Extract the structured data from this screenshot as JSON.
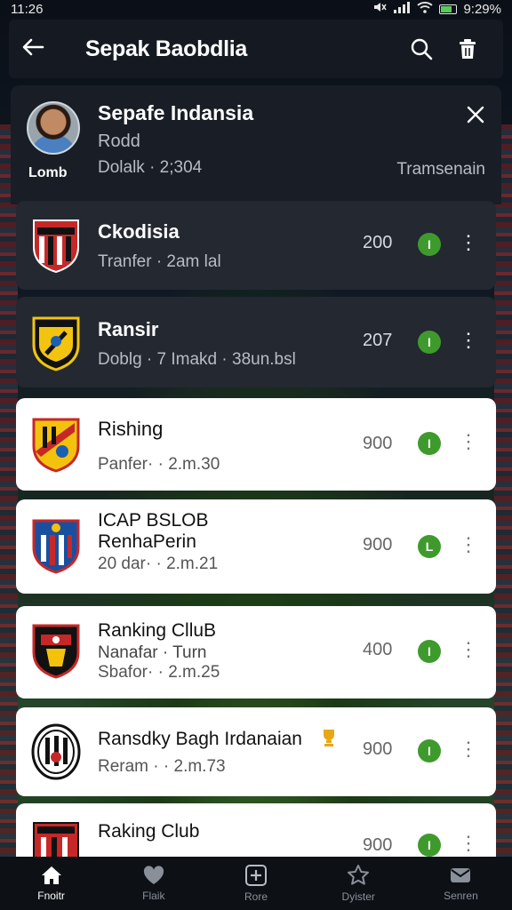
{
  "status_bar": {
    "time": "11:26",
    "battery_text": "9:29%"
  },
  "app_bar": {
    "title": "Sepak Baobdlia"
  },
  "header_card": {
    "name": "Sepafe Indansia",
    "subtitle": "Rodd",
    "meta": "Dolalk · 2;304",
    "avatar_label": "Lomb",
    "status": "Tramsenain"
  },
  "clubs": [
    {
      "name": "Ckodisia",
      "sub": "Tranfer · 2am lal",
      "points": "200",
      "badge": "I",
      "style": "dark"
    },
    {
      "name": "Ransir",
      "sub": "Doblg · 7 Imakd · 38un.bsl",
      "points": "207",
      "badge": "I",
      "style": "dark"
    },
    {
      "name": "Rishing",
      "sub": "Panfer· · 2.m.30",
      "points": "900",
      "badge": "I",
      "style": "light"
    },
    {
      "name": "ICAP BSLOB",
      "name2": "RenhaPerin",
      "sub": "20 dar· · 2.m.21",
      "points": "900",
      "badge": "L",
      "style": "light"
    },
    {
      "name": "Ranking ClluB",
      "name2": "Nanafar · Turn",
      "sub": "Sbafor· · 2.m.25",
      "points": "400",
      "badge": "I",
      "style": "light"
    },
    {
      "name": "Ransdky Bagh Irdanaian",
      "sub": "Reram · · 2.m.73",
      "points": "900",
      "badge": "I",
      "style": "light"
    },
    {
      "name": "Raking Club",
      "sub": "",
      "points": "900",
      "badge": "I",
      "style": "light"
    }
  ],
  "bottom_nav": [
    {
      "label": "Fnoitr",
      "icon": "home-icon"
    },
    {
      "label": "Flaik",
      "icon": "heart-icon"
    },
    {
      "label": "Rore",
      "icon": "add-box-icon"
    },
    {
      "label": "Dyister",
      "icon": "star-icon"
    },
    {
      "label": "Senren",
      "icon": "mail-icon"
    }
  ],
  "colors": {
    "accent_green": "#3f9a2d",
    "dark_card": "#232831",
    "bar_bg": "#151a22"
  }
}
